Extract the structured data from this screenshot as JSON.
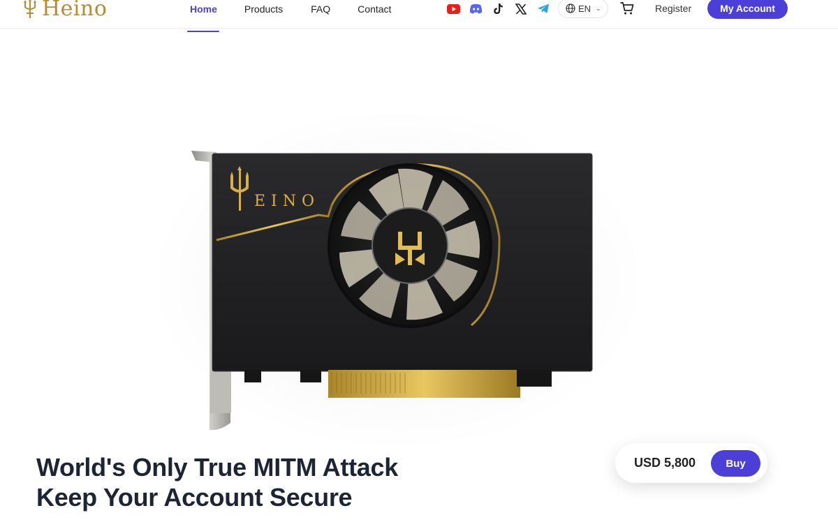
{
  "brand": {
    "name": "Heino"
  },
  "nav": {
    "items": [
      {
        "label": "Home",
        "active": true
      },
      {
        "label": "Products"
      },
      {
        "label": "FAQ"
      },
      {
        "label": "Contact"
      }
    ]
  },
  "socials": [
    "youtube-icon",
    "discord-icon",
    "tiktok-icon",
    "x-icon",
    "telegram-icon"
  ],
  "language": {
    "selected": "EN"
  },
  "header_actions": {
    "register_label": "Register",
    "account_label": "My Account"
  },
  "product": {
    "card_brand_text": "EINO",
    "headline_line1": "World's Only True MITM Attack",
    "headline_line2": "Keep Your Account Secure",
    "price": "USD 5,800",
    "buy_label": "Buy"
  },
  "colors": {
    "accent": "#4b3fd8",
    "gold": "#b98a35",
    "youtube": "#e62117",
    "discord": "#5865f2",
    "telegram": "#2aa3de"
  }
}
